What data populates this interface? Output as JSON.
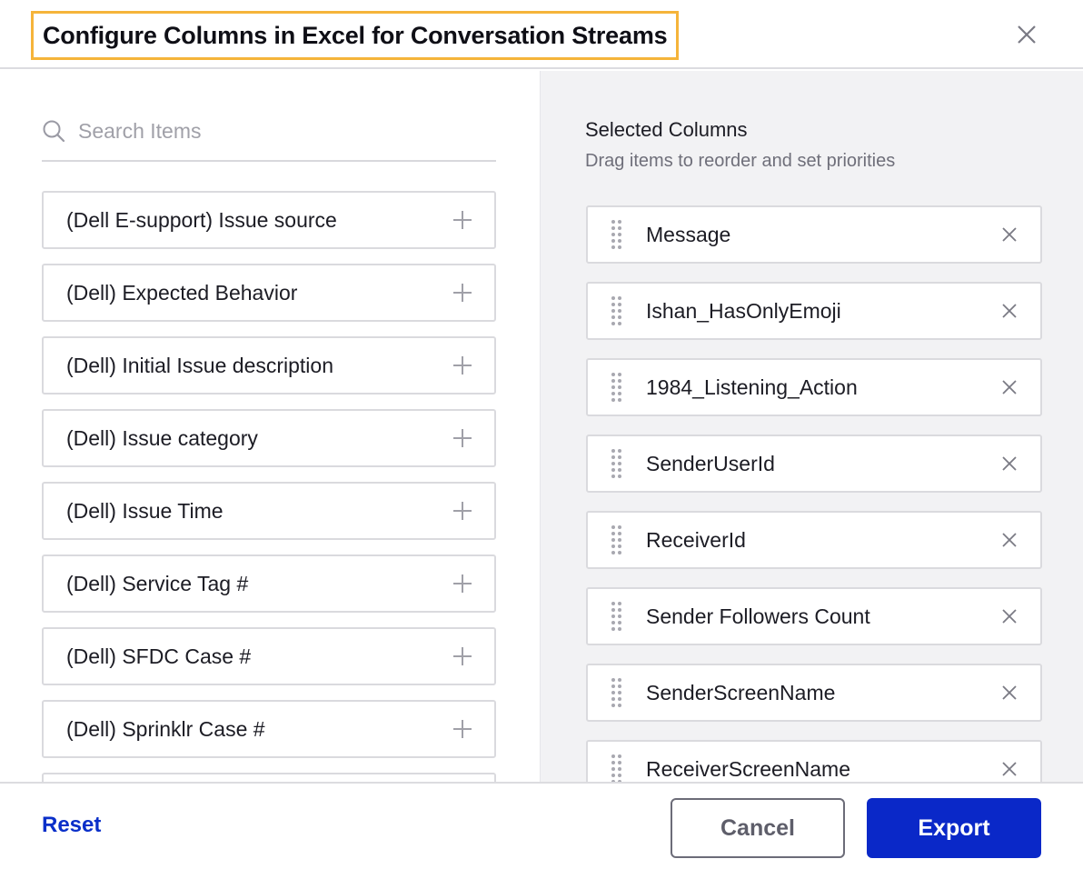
{
  "header": {
    "title": "Configure Columns in Excel for Conversation Streams",
    "close_icon": "close-icon"
  },
  "available": {
    "search": {
      "placeholder": "Search Items",
      "value": "",
      "icon": "search-icon"
    },
    "items": [
      {
        "label": "(Dell E-support) Issue source",
        "icon": "plus-icon"
      },
      {
        "label": "(Dell) Expected Behavior",
        "icon": "plus-icon"
      },
      {
        "label": "(Dell) Initial Issue description",
        "icon": "plus-icon"
      },
      {
        "label": "(Dell) Issue category",
        "icon": "plus-icon"
      },
      {
        "label": "(Dell) Issue Time",
        "icon": "plus-icon"
      },
      {
        "label": "(Dell) Service Tag #",
        "icon": "plus-icon"
      },
      {
        "label": "(Dell) SFDC Case #",
        "icon": "plus-icon"
      },
      {
        "label": "(Dell) Sprinklr Case #",
        "icon": "plus-icon"
      },
      {
        "label": "",
        "icon": "plus-icon"
      }
    ]
  },
  "selected": {
    "title": "Selected Columns",
    "subtitle": "Drag items to reorder and set priorities",
    "items": [
      {
        "label": "Message"
      },
      {
        "label": "Ishan_HasOnlyEmoji"
      },
      {
        "label": "1984_Listening_Action"
      },
      {
        "label": "SenderUserId"
      },
      {
        "label": "ReceiverId"
      },
      {
        "label": "Sender Followers Count"
      },
      {
        "label": "SenderScreenName"
      },
      {
        "label": "ReceiverScreenName"
      }
    ]
  },
  "footer": {
    "reset_label": "Reset",
    "cancel_label": "Cancel",
    "export_label": "Export"
  },
  "colors": {
    "accent": "#0a28c8",
    "link": "#0a2fc9",
    "title_highlight": "#f5b43a",
    "panel_bg": "#f2f2f4"
  }
}
